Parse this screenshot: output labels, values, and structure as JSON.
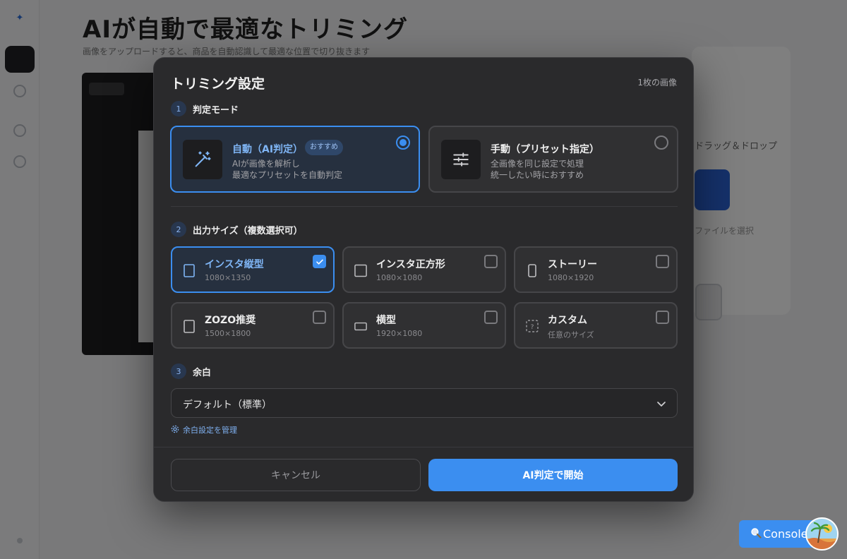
{
  "background": {
    "title": "AIが自動で最適なトリミング",
    "subtitle": "画像をアップロードすると、商品を自動認識して最適な位置で切り抜きます",
    "card_text": "ドラッグ＆ドロップ",
    "card_text2": "ファイルを選択"
  },
  "modal": {
    "title": "トリミング設定",
    "image_count": "1枚の画像",
    "step1": {
      "num": "1",
      "label": "判定モード"
    },
    "modes": [
      {
        "title": "自動（AI判定）",
        "badge": "おすすめ",
        "desc1": "AIが画像を解析し",
        "desc2": "最適なプリセットを自動判定",
        "icon": "magic-wand-icon",
        "selected": true
      },
      {
        "title": "手動（プリセット指定）",
        "desc1": "全画像を同じ設定で処理",
        "desc2": "統一したい時におすすめ",
        "icon": "sliders-icon",
        "selected": false
      }
    ],
    "step2": {
      "num": "2",
      "label": "出力サイズ（複数選択可）"
    },
    "sizes": [
      {
        "title": "インスタ縦型",
        "sub": "1080×1350",
        "icon": "portrait-rect-icon",
        "checked": true
      },
      {
        "title": "インスタ正方形",
        "sub": "1080×1080",
        "icon": "square-icon",
        "checked": false
      },
      {
        "title": "ストーリー",
        "sub": "1080×1920",
        "icon": "phone-icon",
        "checked": false
      },
      {
        "title": "ZOZO推奨",
        "sub": "1500×1800",
        "icon": "portrait-rect-icon",
        "checked": false
      },
      {
        "title": "横型",
        "sub": "1920×1080",
        "icon": "landscape-rect-icon",
        "checked": false
      },
      {
        "title": "カスタム",
        "sub": "任意のサイズ",
        "icon": "dashed-rect-icon",
        "checked": false
      }
    ],
    "step3": {
      "num": "3",
      "label": "余白"
    },
    "margin_select": {
      "value": "デフォルト（標準）"
    },
    "manage_link": "余白設定を管理",
    "cancel_label": "キャンセル",
    "start_label": "AI判定で開始"
  },
  "console": {
    "label": "Console"
  },
  "colors": {
    "accent": "#3b8ef0",
    "modal_bg": "#2a2a2c",
    "selected_bg": "#26303f"
  }
}
